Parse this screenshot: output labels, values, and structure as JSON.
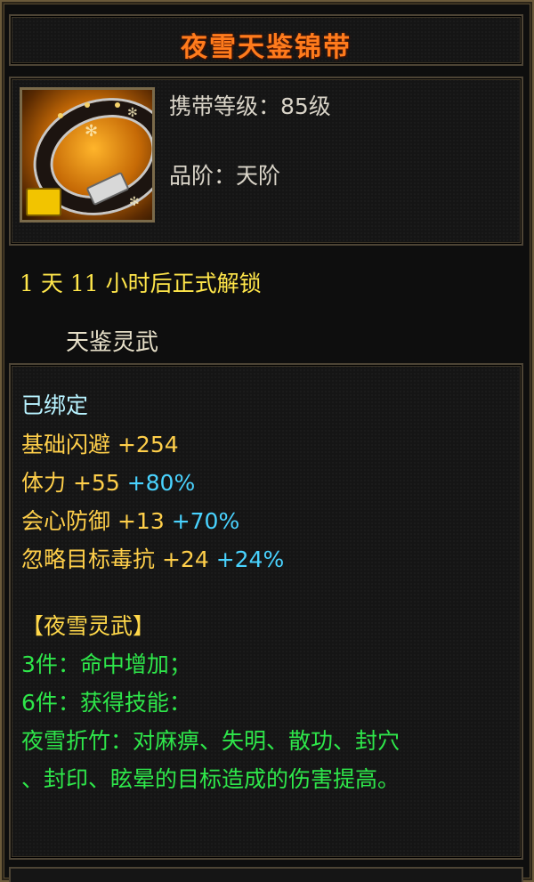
{
  "item": {
    "name": "夜雪天鉴锦带",
    "carry_level": "携带等级：85级",
    "grade": "品阶：天阶",
    "icon": "belt-icon"
  },
  "unlock": {
    "days": "1",
    "day_label": "天",
    "hours": "11",
    "hour_label": "小时后正式解锁"
  },
  "set_label": "天鉴灵武",
  "bound": "已绑定",
  "stats": [
    {
      "name": "基础闪避",
      "value": "+254",
      "pct": ""
    },
    {
      "name": "体力",
      "value": "+55",
      "pct": "+80%"
    },
    {
      "name": "会心防御",
      "value": "+13",
      "pct": "+70%"
    },
    {
      "name": "忽略目标毒抗",
      "value": "+24",
      "pct": "+24%"
    }
  ],
  "set": {
    "title": "【夜雪灵武】",
    "piece3": "3件：命中增加；",
    "piece6": "6件：获得技能：",
    "skill_line1": "夜雪折竹：对麻痹、失明、散功、封穴",
    "skill_line2": "、封印、眩晕的目标造成的伤害提高。"
  },
  "colors": {
    "title": "#ff7b1c",
    "stat": "#ffcf4a",
    "pct": "#49d3ff",
    "set_effect": "#2ee64a"
  }
}
